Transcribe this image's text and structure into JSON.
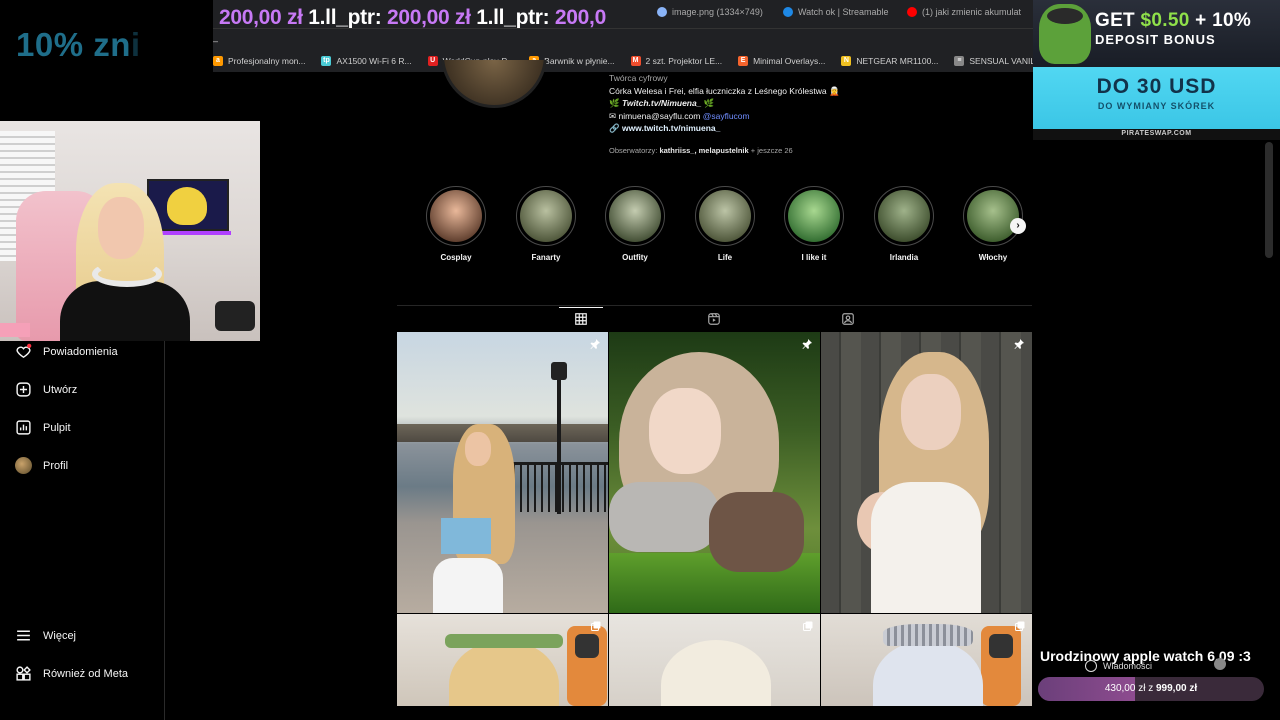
{
  "promo_left": {
    "text_bright": "10% zn",
    "text_fade": "i"
  },
  "browser": {
    "ticker": [
      {
        "amount": "200,00 zł",
        "name": "1.ll_ptr:"
      },
      {
        "amount": "200,00 zł",
        "name": "1.ll_ptr:"
      },
      {
        "amount": "200,0"
      }
    ],
    "tabs": [
      {
        "label": "image.png (1334×749)",
        "color": "#8ab4f8"
      },
      {
        "label": "Watch ok | Streamable",
        "color": "#1e88e5"
      },
      {
        "label": "(1) jaki zmienic akumulat",
        "color": "#ff0000"
      }
    ],
    "tab_dash": "–",
    "bookmarks": [
      {
        "label": "Profesjonalny mon...",
        "icon": "a",
        "color": "#ff9900"
      },
      {
        "label": "AX1500 Wi-Fi 6 R...",
        "icon": "tp",
        "color": "#4acbd6"
      },
      {
        "label": "WorldCup-play-P...",
        "icon": "U",
        "color": "#e02020"
      },
      {
        "label": "Barwnik w płynie...",
        "icon": "a",
        "color": "#ff9900"
      },
      {
        "label": "2 szt. Projektor LE...",
        "icon": "M",
        "color": "#ee4d2d"
      },
      {
        "label": "Minimal Overlays...",
        "icon": "E",
        "color": "#f5642d"
      },
      {
        "label": "NETGEAR MR1100...",
        "icon": "N",
        "color": "#f0c020"
      },
      {
        "label": "SENSUAL VANILL...",
        "icon": "≡",
        "color": "#888888"
      }
    ]
  },
  "sidebar": {
    "items": [
      {
        "label": "Powiadomienia",
        "icon": "heart-icon"
      },
      {
        "label": "Utwórz",
        "icon": "plus-square-icon"
      },
      {
        "label": "Pulpit",
        "icon": "bar-chart-icon"
      },
      {
        "label": "Profil",
        "icon": "avatar"
      },
      {
        "label": "Więcej",
        "icon": "menu-icon"
      },
      {
        "label": "Również od Meta",
        "icon": "meta-grid-icon"
      }
    ]
  },
  "profile": {
    "category": "Twórca cyfrowy",
    "bio_line": "Córka Welesa i Frei, elfia łuczniczka z Leśnego Królestwa 🧝",
    "twitch_handle": "Twitch.tv/Nimuena_",
    "email": "nimuena@sayflu.com",
    "mention": "@sayflucom",
    "link": "www.twitch.tv/nimuena_",
    "followers_prefix": "Obserwatorzy:",
    "followers_names": "kathriiss_, melapustelnik",
    "followers_suffix": "+ jeszcze 26"
  },
  "highlights": [
    {
      "label": "Cosplay",
      "color1": "#e9b89a",
      "color2": "#5a3a2a"
    },
    {
      "label": "Fanarty",
      "color1": "#b9c0a0",
      "color2": "#4a5236"
    },
    {
      "label": "Outfity",
      "color1": "#c4ccb0",
      "color2": "#3e4a30"
    },
    {
      "label": "Life",
      "color1": "#bcc4a6",
      "color2": "#4a5236"
    },
    {
      "label": "I like it",
      "color1": "#a8d890",
      "color2": "#2e6a2e"
    },
    {
      "label": "Irlandia",
      "color1": "#9fb28a",
      "color2": "#3a4a2a"
    },
    {
      "label": "Włochy",
      "color1": "#a6c08c",
      "color2": "#3a5a2a"
    }
  ],
  "content_tabs": [
    "posts-grid",
    "reels",
    "tagged"
  ],
  "ad": {
    "get": "GET ",
    "amount": "$0.50",
    "plus": " + 10%",
    "line2": "DEPOSIT BONUS",
    "big": "DO 30 USD",
    "small": "DO WYMIANY SKÓREK",
    "site": "PIRATESWAP.COM"
  },
  "goal": {
    "title": "Urodzinowy apple watch 6.09 :3",
    "messages": "Wiadomości",
    "current": "430,00 zł",
    "separator": "z",
    "target": "999,00 zł",
    "progress": 0.43
  }
}
